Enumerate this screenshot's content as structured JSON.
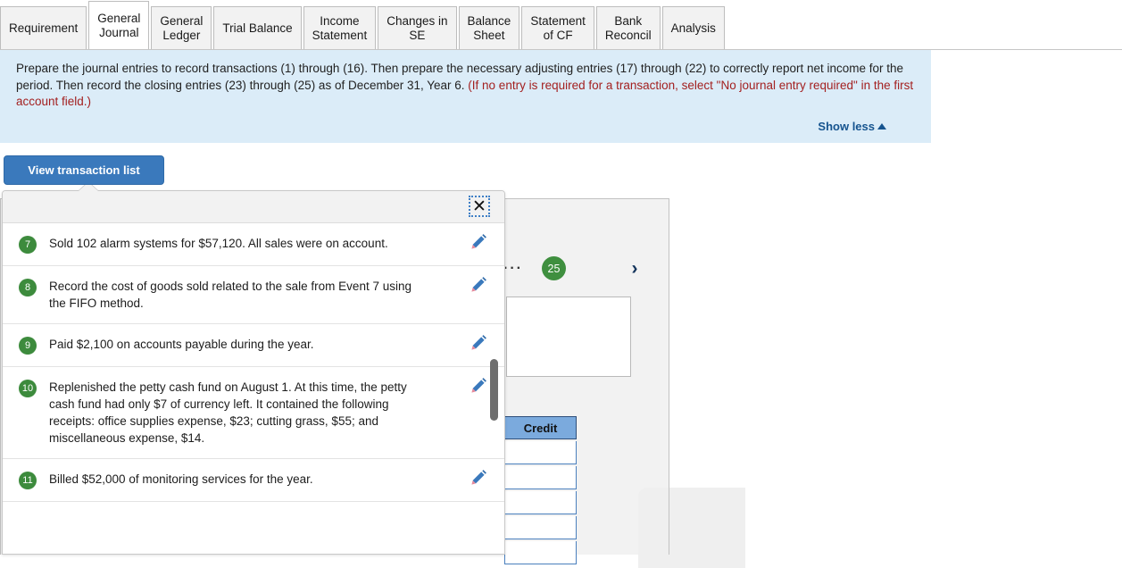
{
  "tabs": [
    {
      "label": "Requirement",
      "active": false
    },
    {
      "label": "General\nJournal",
      "active": true
    },
    {
      "label": "General\nLedger",
      "active": false
    },
    {
      "label": "Trial Balance",
      "active": false
    },
    {
      "label": "Income\nStatement",
      "active": false
    },
    {
      "label": "Changes in\nSE",
      "active": false
    },
    {
      "label": "Balance\nSheet",
      "active": false
    },
    {
      "label": "Statement\nof CF",
      "active": false
    },
    {
      "label": "Bank\nReconcil",
      "active": false
    },
    {
      "label": "Analysis",
      "active": false
    }
  ],
  "banner": {
    "text_part1": "Prepare the journal entries to record transactions (1) through (16). Then prepare the necessary adjusting entries (17) through (22) to correctly report net income for the period. Then record the closing entries (23) through (25) as of December 31, Year 6. ",
    "text_part2_red": "(If no entry is required for a transaction, select \"No journal entry required\" in the first account field.)",
    "show_less_label": "Show less",
    "background_color": "#dbecf8"
  },
  "view_button": {
    "label": "View transaction list",
    "color": "#3a79bc"
  },
  "popover": {
    "close_label": "✕",
    "transactions": [
      {
        "num": "7",
        "text": "Sold 102 alarm systems for $57,120. All sales were on account."
      },
      {
        "num": "8",
        "text": "Record the cost of goods sold related to the sale from Event 7 using the FIFO method."
      },
      {
        "num": "9",
        "text": "Paid $2,100 on accounts payable during the year."
      },
      {
        "num": "10",
        "text": "Replenished the petty cash fund on August 1. At this time, the petty cash fund had only $7 of currency left. It contained the following receipts: office supplies expense, $23; cutting grass, $55; and miscellaneous expense, $14."
      },
      {
        "num": "11",
        "text": "Billed $52,000 of monitoring services for the year."
      }
    ],
    "badge_color": "#3d8b3d",
    "edit_icon_name": "pencil-icon"
  },
  "journal_panel": {
    "nav_ellipsis": "···",
    "current_entry_badge": "25",
    "next_label": "›",
    "credit_header": "Credit",
    "credit_rows": [
      "",
      "",
      "",
      "",
      ""
    ]
  }
}
